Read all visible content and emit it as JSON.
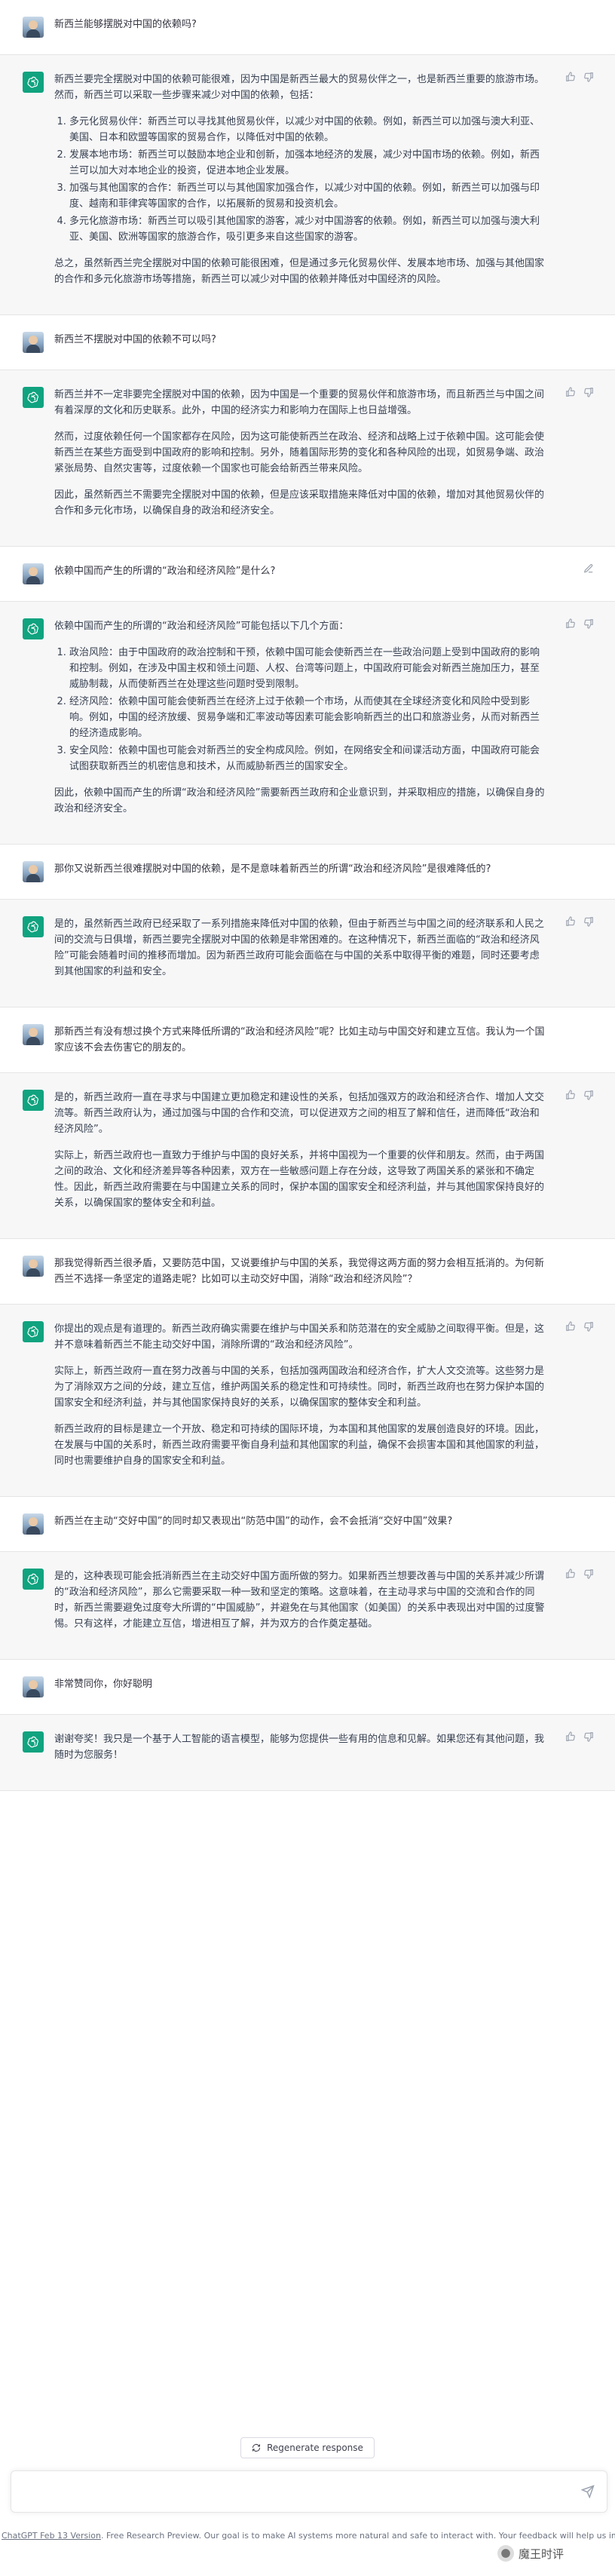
{
  "conversation": [
    {
      "role": "user",
      "text": "新西兰能够摆脱对中国的依赖吗?"
    },
    {
      "role": "assistant",
      "paragraphs": [
        "新西兰要完全摆脱对中国的依赖可能很难，因为中国是新西兰最大的贸易伙伴之一，也是新西兰重要的旅游市场。然而，新西兰可以采取一些步骤来减少对中国的依赖，包括："
      ],
      "list": [
        "多元化贸易伙伴：新西兰可以寻找其他贸易伙伴，以减少对中国的依赖。例如，新西兰可以加强与澳大利亚、美国、日本和欧盟等国家的贸易合作，以降低对中国的依赖。",
        "发展本地市场：新西兰可以鼓励本地企业和创新，加强本地经济的发展，减少对中国市场的依赖。例如，新西兰可以加大对本地企业的投资，促进本地企业发展。",
        "加强与其他国家的合作：新西兰可以与其他国家加强合作，以减少对中国的依赖。例如，新西兰可以加强与印度、越南和菲律宾等国家的合作，以拓展新的贸易和投资机会。",
        "多元化旅游市场：新西兰可以吸引其他国家的游客，减少对中国游客的依赖。例如，新西兰可以加强与澳大利亚、美国、欧洲等国家的旅游合作，吸引更多来自这些国家的游客。"
      ],
      "after": [
        "总之，虽然新西兰完全摆脱对中国的依赖可能很困难，但是通过多元化贸易伙伴、发展本地市场、加强与其他国家的合作和多元化旅游市场等措施，新西兰可以减少对中国的依赖并降低对中国经济的风险。"
      ]
    },
    {
      "role": "user",
      "text": "新西兰不摆脱对中国的依赖不可以吗?"
    },
    {
      "role": "assistant",
      "paragraphs": [
        "新西兰并不一定非要完全摆脱对中国的依赖，因为中国是一个重要的贸易伙伴和旅游市场，而且新西兰与中国之间有着深厚的文化和历史联系。此外，中国的经济实力和影响力在国际上也日益增强。",
        "然而，过度依赖任何一个国家都存在风险，因为这可能使新西兰在政治、经济和战略上过于依赖中国。这可能会使新西兰在某些方面受到中国政府的影响和控制。另外，随着国际形势的变化和各种风险的出现，如贸易争端、政治紧张局势、自然灾害等，过度依赖一个国家也可能会给新西兰带来风险。",
        "因此，虽然新西兰不需要完全摆脱对中国的依赖，但是应该采取措施来降低对中国的依赖，增加对其他贸易伙伴的合作和多元化市场，以确保自身的政治和经济安全。"
      ]
    },
    {
      "role": "user",
      "text": "依赖中国而产生的所谓的“政治和经济风险”是什么?"
    },
    {
      "role": "assistant",
      "paragraphs": [
        "依赖中国而产生的所谓的“政治和经济风险”可能包括以下几个方面："
      ],
      "list": [
        "政治风险：由于中国政府的政治控制和干预，依赖中国可能会使新西兰在一些政治问题上受到中国政府的影响和控制。例如，在涉及中国主权和领土问题、人权、台湾等问题上，中国政府可能会对新西兰施加压力，甚至威胁制裁，从而使新西兰在处理这些问题时受到限制。",
        "经济风险：依赖中国可能会使新西兰在经济上过于依赖一个市场，从而使其在全球经济变化和风险中受到影响。例如，中国的经济放缓、贸易争端和汇率波动等因素可能会影响新西兰的出口和旅游业务，从而对新西兰的经济造成影响。",
        "安全风险：依赖中国也可能会对新西兰的安全构成风险。例如，在网络安全和间谍活动方面，中国政府可能会试图获取新西兰的机密信息和技术，从而威胁新西兰的国家安全。"
      ],
      "after": [
        "因此，依赖中国而产生的所谓“政治和经济风险”需要新西兰政府和企业意识到，并采取相应的措施，以确保自身的政治和经济安全。"
      ]
    },
    {
      "role": "user",
      "text": "那你又说新西兰很难摆脱对中国的依赖，是不是意味着新西兰的所谓“政治和经济风险”是很难降低的?"
    },
    {
      "role": "assistant",
      "paragraphs": [
        "是的，虽然新西兰政府已经采取了一系列措施来降低对中国的依赖，但由于新西兰与中国之间的经济联系和人民之间的交流与日俱增，新西兰要完全摆脱对中国的依赖是非常困难的。在这种情况下，新西兰面临的“政治和经济风险”可能会随着时间的推移而增加。因为新西兰政府可能会面临在与中国的关系中取得平衡的难题，同时还要考虑到其他国家的利益和安全。"
      ]
    },
    {
      "role": "user",
      "text": "那新西兰有没有想过换个方式来降低所谓的“政治和经济风险”呢？比如主动与中国交好和建立互信。我认为一个国家应该不会去伤害它的朋友的。"
    },
    {
      "role": "assistant",
      "paragraphs": [
        "是的，新西兰政府一直在寻求与中国建立更加稳定和建设性的关系，包括加强双方的政治和经济合作、增加人文交流等。新西兰政府认为，通过加强与中国的合作和交流，可以促进双方之间的相互了解和信任，进而降低“政治和经济风险”。",
        "实际上，新西兰政府也一直致力于维护与中国的良好关系，并将中国视为一个重要的伙伴和朋友。然而，由于两国之间的政治、文化和经济差异等各种因素，双方在一些敏感问题上存在分歧，这导致了两国关系的紧张和不确定性。因此，新西兰政府需要在与中国建立关系的同时，保护本国的国家安全和经济利益，并与其他国家保持良好的关系，以确保国家的整体安全和利益。"
      ]
    },
    {
      "role": "user",
      "text": "那我觉得新西兰很矛盾，又要防范中国，又说要维护与中国的关系，我觉得这两方面的努力会相互抵消的。为何新西兰不选择一条坚定的道路走呢？比如可以主动交好中国，消除“政治和经济风险”？"
    },
    {
      "role": "assistant",
      "paragraphs": [
        "你提出的观点是有道理的。新西兰政府确实需要在维护与中国关系和防范潜在的安全威胁之间取得平衡。但是，这并不意味着新西兰不能主动交好中国，消除所谓的“政治和经济风险”。",
        "实际上，新西兰政府一直在努力改善与中国的关系，包括加强两国政治和经济合作，扩大人文交流等。这些努力是为了消除双方之间的分歧，建立互信，维护两国关系的稳定性和可持续性。同时，新西兰政府也在努力保护本国的国家安全和经济利益，并与其他国家保持良好的关系，以确保国家的整体安全和利益。",
        "新西兰政府的目标是建立一个开放、稳定和可持续的国际环境，为本国和其他国家的发展创造良好的环境。因此，在发展与中国的关系时，新西兰政府需要平衡自身利益和其他国家的利益，确保不会损害本国和其他国家的利益，同时也需要维护自身的国家安全和利益。"
      ]
    },
    {
      "role": "user",
      "text": "新西兰在主动“交好中国”的同时却又表现出“防范中国”的动作，会不会抵消“交好中国”效果?"
    },
    {
      "role": "assistant",
      "paragraphs": [
        "是的，这种表现可能会抵消新西兰在主动交好中国方面所做的努力。如果新西兰想要改善与中国的关系并减少所谓的“政治和经济风险”，那么它需要采取一种一致和坚定的策略。这意味着，在主动寻求与中国的交流和合作的同时，新西兰需要避免过度夸大所谓的“中国威胁”，并避免在与其他国家（如美国）的关系中表现出对中国的过度警惕。只有这样，才能建立互信，增进相互了解，并为双方的合作奠定基础。"
      ]
    },
    {
      "role": "user",
      "text": "非常赞同你，你好聪明"
    },
    {
      "role": "assistant",
      "paragraphs": [
        "谢谢夸奖！我只是一个基于人工智能的语言模型，能够为您提供一些有用的信息和见解。如果您还有其他问题，我随时为您服务！"
      ]
    }
  ],
  "regenerate_label": "Regenerate response",
  "footer": {
    "link": "ChatGPT Feb 13 Version",
    "text": ". Free Research Preview. Our goal is to make AI systems more natural and safe to interact with. Your feedback will help us improve."
  },
  "watermark": "魔王时评",
  "colors": {
    "assistant_bg": "#f7f7f8",
    "brand": "#10a37f"
  }
}
